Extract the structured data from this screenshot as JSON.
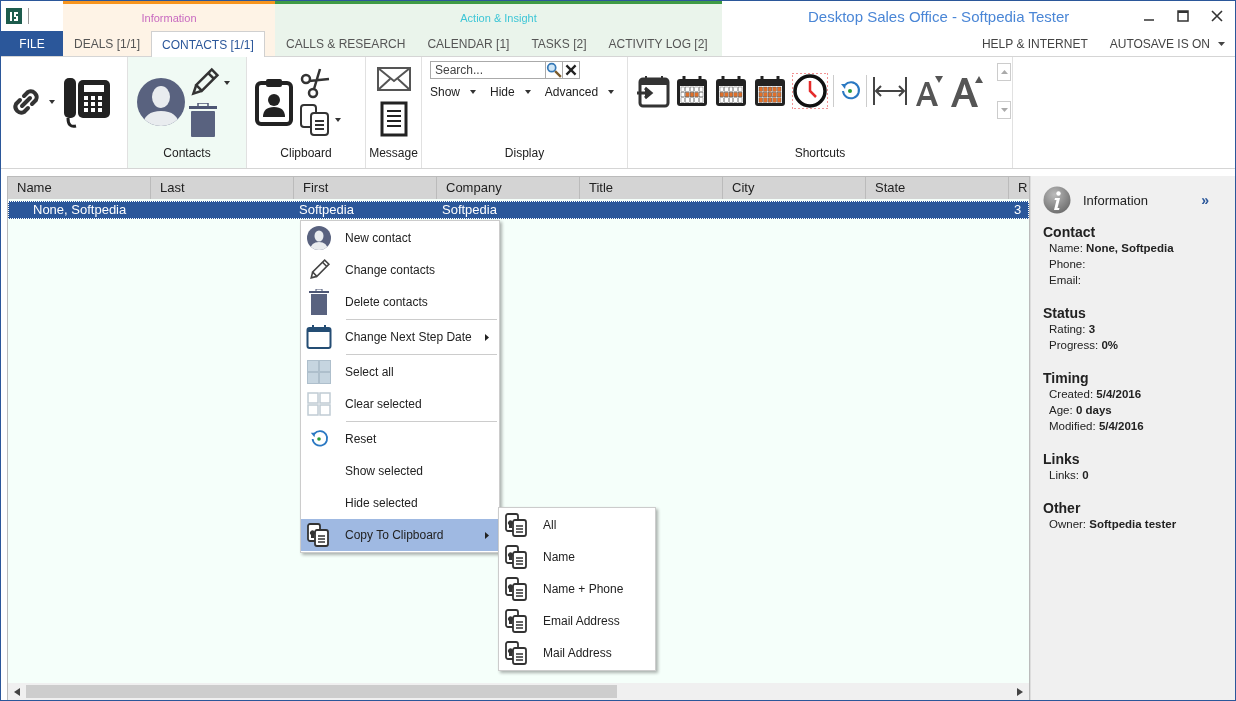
{
  "window": {
    "title": "Desktop Sales Office - Softpedia Tester"
  },
  "file_tab": "FILE",
  "contextual_groups": [
    {
      "label": "Information",
      "color": "#f7941d",
      "tabs": [
        {
          "label": "DEALS [1/1]",
          "selected": false
        },
        {
          "label": "CONTACTS [1/1]",
          "selected": true
        }
      ]
    },
    {
      "label": "Action & Insight",
      "color": "#3e9b45",
      "tabs": [
        {
          "label": "CALLS & RESEARCH",
          "selected": false
        },
        {
          "label": "CALENDAR [1]",
          "selected": false
        },
        {
          "label": "TASKS [2]",
          "selected": false
        },
        {
          "label": "ACTIVITY LOG [2]",
          "selected": false
        }
      ]
    }
  ],
  "right_tabs": [
    {
      "label": "HELP & INTERNET",
      "dropdown": false
    },
    {
      "label": "AUTOSAVE IS ON",
      "dropdown": true
    }
  ],
  "ribbon": {
    "groups": [
      {
        "kind": "links",
        "highlighted": false
      },
      {
        "kind": "contacts",
        "label": "Contacts",
        "highlighted": true
      },
      {
        "kind": "clipboard",
        "label": "Clipboard",
        "highlighted": false
      },
      {
        "kind": "message",
        "label": "Message",
        "highlighted": false
      },
      {
        "kind": "display",
        "label": "Display",
        "highlighted": false,
        "search": {
          "placeholder": "Search..."
        },
        "menus": [
          "Show",
          "Hide",
          "Advanced"
        ]
      },
      {
        "kind": "shortcuts",
        "label": "Shortcuts",
        "highlighted": false
      }
    ]
  },
  "table": {
    "columns": [
      "Name",
      "Last",
      "First",
      "Company",
      "Title",
      "City",
      "State",
      "R"
    ],
    "rows": [
      {
        "selected": true,
        "name": "None, Softpedia",
        "first": "Softpedia",
        "company": "Softpedia",
        "column_8": "3"
      }
    ]
  },
  "context_menu": {
    "items": [
      {
        "kind": "item",
        "label": "New contact",
        "submenu": false,
        "highlighted": false
      },
      {
        "kind": "item",
        "label": "Change contacts",
        "submenu": false,
        "highlighted": false
      },
      {
        "kind": "item",
        "label": "Delete contacts",
        "submenu": false,
        "highlighted": false
      },
      {
        "kind": "separator"
      },
      {
        "kind": "item",
        "label": "Change Next Step Date",
        "submenu": true,
        "highlighted": false
      },
      {
        "kind": "separator"
      },
      {
        "kind": "item",
        "label": "Select all",
        "submenu": false,
        "highlighted": false
      },
      {
        "kind": "item",
        "label": "Clear selected",
        "submenu": false,
        "highlighted": false
      },
      {
        "kind": "separator"
      },
      {
        "kind": "item",
        "label": "Reset",
        "submenu": false,
        "highlighted": false
      },
      {
        "kind": "item",
        "label": "Show selected",
        "submenu": false,
        "highlighted": false
      },
      {
        "kind": "item",
        "label": "Hide selected",
        "submenu": false,
        "highlighted": false
      },
      {
        "kind": "item",
        "label": "Copy To Clipboard",
        "submenu": true,
        "highlighted": true
      }
    ]
  },
  "submenu": {
    "items": [
      "All",
      "Name",
      "Name + Phone",
      "Email Address",
      "Mail Address"
    ]
  },
  "info_panel": {
    "title": "Information",
    "collapse": "»",
    "sections": [
      {
        "heading": "Contact",
        "fields": [
          {
            "label": "Name:",
            "value": "None, Softpedia"
          },
          {
            "label": "Phone:"
          },
          {
            "label": "Email:"
          }
        ]
      },
      {
        "heading": "Status",
        "fields": [
          {
            "label": "Rating:",
            "value": "3"
          },
          {
            "label": "Progress:",
            "value": "0%"
          }
        ]
      },
      {
        "heading": "Timing",
        "fields": [
          {
            "label": "Created:",
            "value": "5/4/2016"
          },
          {
            "label": "Age:",
            "value": "0 days"
          },
          {
            "label": "Modified:",
            "value": "5/4/2016"
          }
        ]
      },
      {
        "heading": "Links",
        "fields": [
          {
            "label": "Links:",
            "value": "0"
          }
        ]
      },
      {
        "heading": "Other",
        "fields": [
          {
            "label": "Owner:",
            "value": "Softpedia tester"
          }
        ]
      }
    ]
  }
}
